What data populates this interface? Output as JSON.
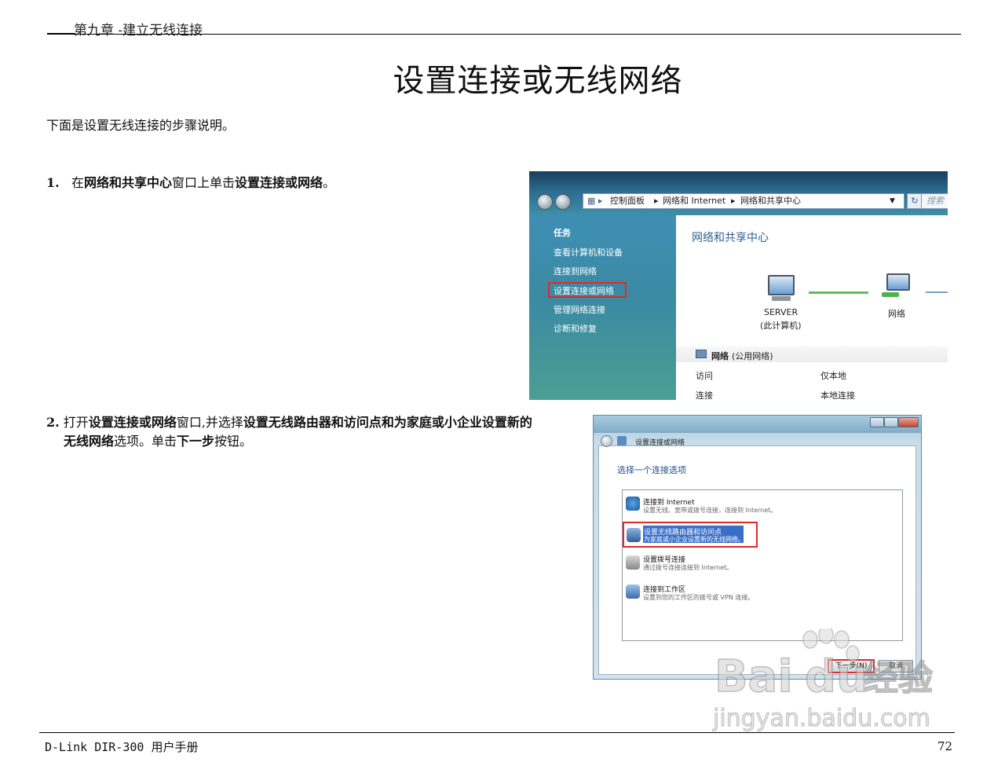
{
  "header": {
    "chapter": "第九章 -建立无线连接"
  },
  "title": "设置连接或无线网络",
  "intro": "下面是设置无线连接的步骤说明。",
  "steps": [
    {
      "num": "1.",
      "pre": "在",
      "b1": "网络和共享中心",
      "mid": "窗口上单击",
      "b2": "设置连接或网络",
      "post": "。"
    },
    {
      "num": "2.",
      "pre": "打开",
      "b1": "设置连接或网络",
      "mid": "窗口,并选择",
      "b2": "设置无线路由器和访问点和为家庭或小企业设置新的",
      "b2b": "无线网络",
      "mid2": "选项。单击",
      "b3": "下一步",
      "post": "按钮。"
    }
  ],
  "screenshot1": {
    "breadcrumb": [
      "控制面板",
      "网络和 Internet",
      "网络和共享中心"
    ],
    "search": "搜索",
    "sidebar_heading": "任务",
    "sidebar_items": [
      "查看计算机和设备",
      "连接到网络",
      "设置连接或网络",
      "管理网络连接",
      "诊断和修复"
    ],
    "heading": "网络和共享中心",
    "computer_name": "SERVER",
    "computer_sub": "(此计算机)",
    "network_label": "网络",
    "network_status_name": "网络",
    "network_status_type": "(公用网络)",
    "rows": [
      {
        "label": "访问",
        "value": "仅本地"
      },
      {
        "label": "连接",
        "value": "本地连接"
      }
    ]
  },
  "screenshot2": {
    "window_title": "设置连接或网络",
    "choose": "选择一个连接选项",
    "options": [
      {
        "title": "连接到 Internet",
        "desc": "设置无线、宽带或拨号连接，连接到 Internet。"
      },
      {
        "title": "设置无线路由器和访问点",
        "desc": "为家庭或小企业设置新的无线网络。"
      },
      {
        "title": "设置拨号连接",
        "desc": "通过拨号连接连接到 Internet。"
      },
      {
        "title": "连接到工作区",
        "desc": "设置到您的工作区的拨号或 VPN 连接。"
      }
    ],
    "next": "下一步(N)",
    "cancel": "取消"
  },
  "watermark": {
    "brand": "Bai",
    "brand2": "du",
    "brand_cn": "经验",
    "url": "jingyan.baidu.com"
  },
  "footer": {
    "left": "D-Link DIR-300 用户手册",
    "page": "72"
  }
}
